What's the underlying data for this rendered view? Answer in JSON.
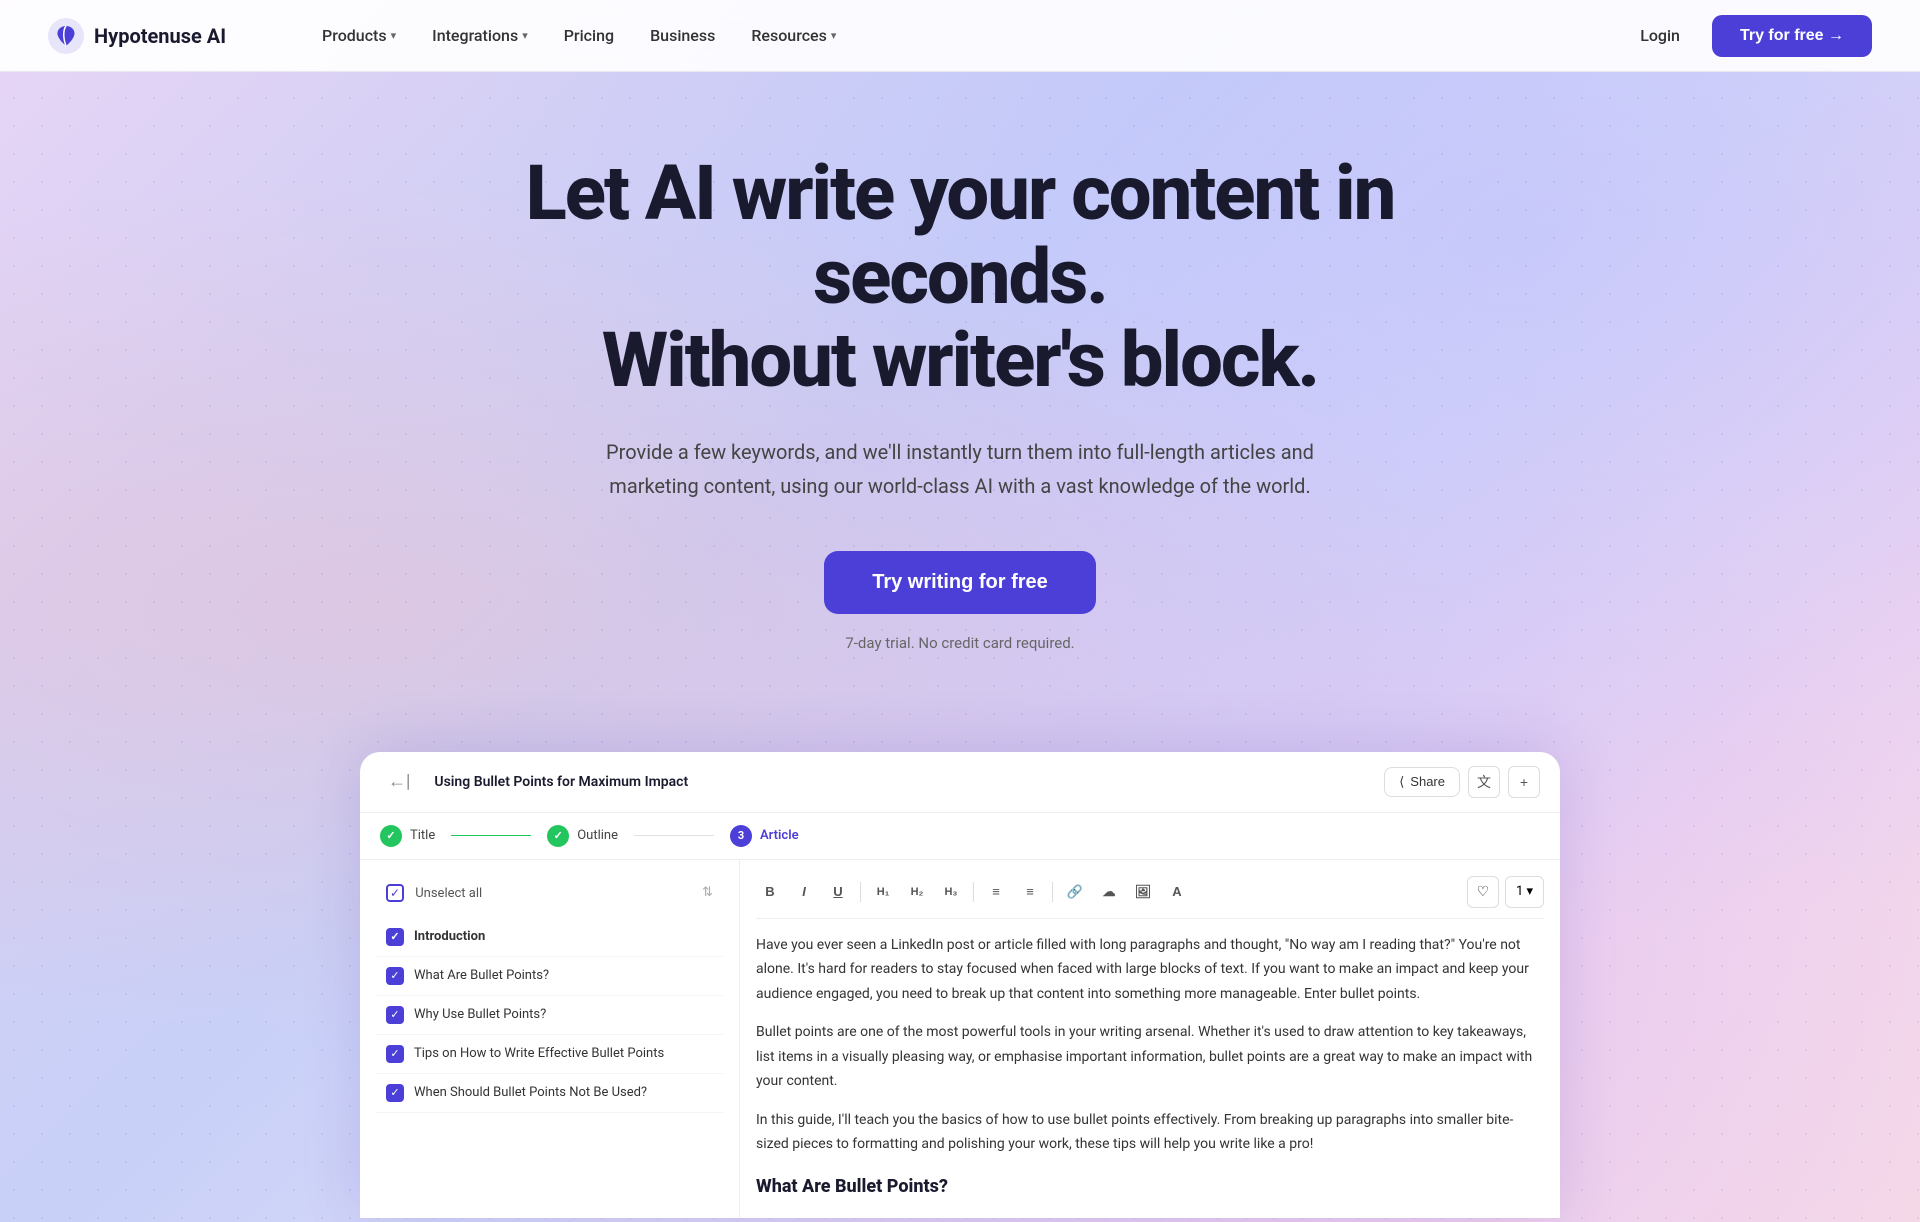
{
  "nav": {
    "logo_text": "Hypotenuse AI",
    "links": [
      {
        "label": "Products",
        "has_chevron": true
      },
      {
        "label": "Integrations",
        "has_chevron": true
      },
      {
        "label": "Pricing",
        "has_chevron": false
      },
      {
        "label": "Business",
        "has_chevron": false
      },
      {
        "label": "Resources",
        "has_chevron": true
      }
    ],
    "login_label": "Login",
    "cta_label": "Try for free →"
  },
  "hero": {
    "title_line1": "Let AI write your content in seconds.",
    "title_line2": "Without writer's block.",
    "subtitle": "Provide a few keywords, and we'll instantly turn them into full-length articles and marketing content, using our world-class AI with a vast knowledge of the world.",
    "cta_label": "Try writing for free",
    "trial_note": "7-day trial. No credit card required."
  },
  "app_preview": {
    "title": "Using Bullet Points for Maximum Impact",
    "share_label": "Share",
    "back_arrow": "←|",
    "steps": [
      {
        "label": "Title",
        "state": "done"
      },
      {
        "label": "Outline",
        "state": "done"
      },
      {
        "label": "Article",
        "state": "active",
        "number": "3"
      }
    ],
    "outline_header": "Unselect all",
    "outline_items": [
      {
        "label": "Introduction",
        "bold": true
      },
      {
        "label": "What Are Bullet Points?",
        "bold": false
      },
      {
        "label": "Why Use Bullet Points?",
        "bold": false
      },
      {
        "label": "Tips on How to Write Effective Bullet Points",
        "bold": false
      },
      {
        "label": "When Should Bullet Points Not Be Used?",
        "bold": false
      }
    ],
    "editor_content": {
      "paragraphs": [
        "Have you ever seen a LinkedIn post or article filled with long paragraphs and thought, \"No way am I reading that?\" You're not alone. It's hard for readers to stay focused when faced with large blocks of text. If you want to make an impact and keep your audience engaged, you need to break up that content into something more manageable. Enter bullet points.",
        "Bullet points are one of the most powerful tools in your writing arsenal. Whether it's used to draw attention to key takeaways, list items in a visually pleasing way, or emphasise important information, bullet points are a great way to make an impact with your content.",
        "In this guide, I'll teach you the basics of how to use bullet points effectively. From breaking up paragraphs into smaller bite-sized pieces to formatting and polishing your work, these tips will help you write like a pro!"
      ],
      "heading": "What Are Bullet Points?"
    },
    "toolbar_buttons": [
      "B",
      "I",
      "U",
      "H1",
      "H2",
      "H3",
      "≡",
      "≡",
      "🔗",
      "☁",
      "🖼",
      "A"
    ],
    "counter_label": "1 ▾"
  }
}
